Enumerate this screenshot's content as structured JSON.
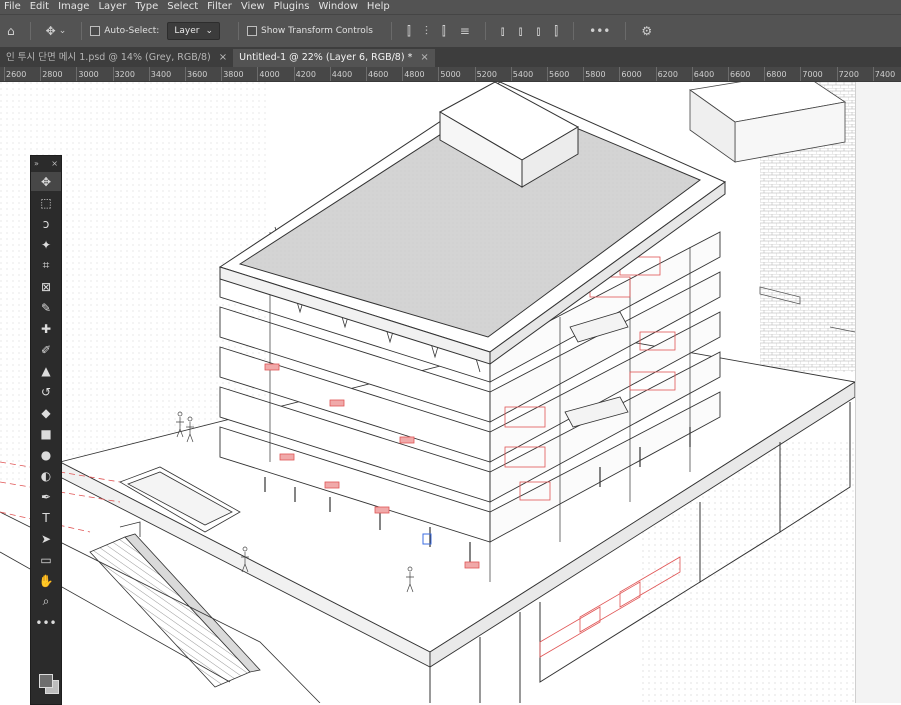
{
  "menu": [
    "File",
    "Edit",
    "Image",
    "Layer",
    "Type",
    "Select",
    "Filter",
    "View",
    "Plugins",
    "Window",
    "Help"
  ],
  "options": {
    "auto_select_label": "Auto-Select:",
    "layer_dropdown": "Layer",
    "transform_label": "Show Transform Controls",
    "more_label": "•••"
  },
  "tabs": [
    {
      "label": "인 투시 단면 메시 1.psd @ 14% (Grey, RGB/8)",
      "active": false,
      "close": "×"
    },
    {
      "label": "Untitled-1 @ 22% (Layer 6, RGB/8) *",
      "active": true,
      "close": "×"
    }
  ],
  "ruler": [
    "2600",
    "2800",
    "3000",
    "3200",
    "3400",
    "3600",
    "3800",
    "4000",
    "4200",
    "4400",
    "4600",
    "4800",
    "5000",
    "5200",
    "5400",
    "5600",
    "5800",
    "6000",
    "6200",
    "6400",
    "6600",
    "6800",
    "7000",
    "7200",
    "7400"
  ],
  "toolbox": {
    "header_left": "»",
    "header_right": "×",
    "tools": [
      {
        "name": "move-tool",
        "glyph": "✥",
        "selected": true
      },
      {
        "name": "marquee-tool",
        "glyph": "⬚",
        "selected": false
      },
      {
        "name": "lasso-tool",
        "glyph": "ↄ",
        "selected": false
      },
      {
        "name": "magic-wand-tool",
        "glyph": "✦",
        "selected": false
      },
      {
        "name": "crop-tool",
        "glyph": "⌗",
        "selected": false
      },
      {
        "name": "frame-tool",
        "glyph": "⊠",
        "selected": false
      },
      {
        "name": "eyedropper-tool",
        "glyph": "✎",
        "selected": false
      },
      {
        "name": "healing-brush-tool",
        "glyph": "✚",
        "selected": false
      },
      {
        "name": "brush-tool",
        "glyph": "✐",
        "selected": false
      },
      {
        "name": "clone-stamp-tool",
        "glyph": "▲",
        "selected": false
      },
      {
        "name": "history-brush-tool",
        "glyph": "↺",
        "selected": false
      },
      {
        "name": "eraser-tool",
        "glyph": "◆",
        "selected": false
      },
      {
        "name": "gradient-tool",
        "glyph": "■",
        "selected": false
      },
      {
        "name": "blur-tool",
        "glyph": "●",
        "selected": false
      },
      {
        "name": "dodge-tool",
        "glyph": "◐",
        "selected": false
      },
      {
        "name": "pen-tool",
        "glyph": "✒",
        "selected": false
      },
      {
        "name": "type-tool",
        "glyph": "T",
        "selected": false
      },
      {
        "name": "path-selection-tool",
        "glyph": "➤",
        "selected": false
      },
      {
        "name": "rectangle-tool",
        "glyph": "▭",
        "selected": false
      },
      {
        "name": "hand-tool",
        "glyph": "✋",
        "selected": false
      },
      {
        "name": "zoom-tool",
        "glyph": "⌕",
        "selected": false
      },
      {
        "name": "edit-toolbar",
        "glyph": "•••",
        "selected": false
      }
    ]
  },
  "colors": {
    "chrome": "#535353",
    "tab_bg": "#3d3d3d",
    "toolbox": "#2b2b2b",
    "drawing_line": "#3a3a3a",
    "accent_red": "#e05555",
    "roof_fill": "#d7d7d7"
  }
}
